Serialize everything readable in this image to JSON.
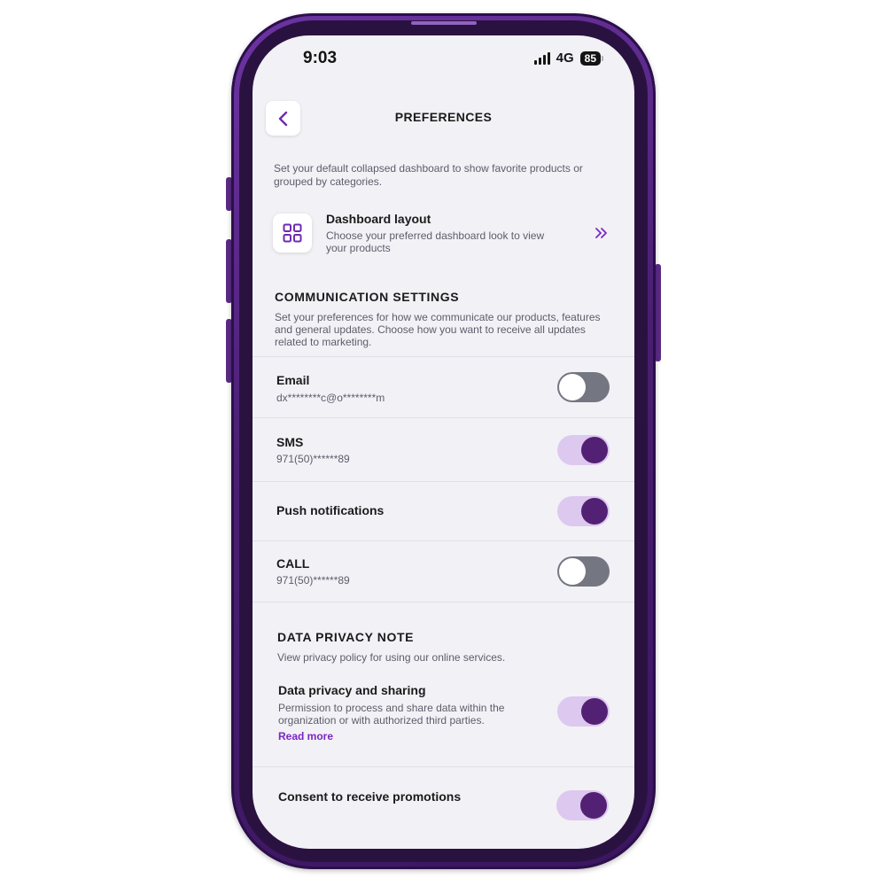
{
  "status_bar": {
    "time": "9:03",
    "network": "4G",
    "battery": "85"
  },
  "header": {
    "title": "PREFERENCES"
  },
  "intro": {
    "text": "Set your default collapsed dashboard to show favorite products or grouped by categories."
  },
  "dashboard": {
    "title": "Dashboard layout",
    "description": "Choose your preferred dashboard look to view your products"
  },
  "communication": {
    "heading": "COMMUNICATION SETTINGS",
    "description": "Set your preferences for how we communicate our products, features and general updates. Choose how you want to receive all updates related to marketing.",
    "items": [
      {
        "title": "Email",
        "subtitle": "dx********c@o********m",
        "enabled": false
      },
      {
        "title": "SMS",
        "subtitle": "971(50)******89",
        "enabled": true
      },
      {
        "title": "Push notifications",
        "enabled": true
      },
      {
        "title": "CALL",
        "subtitle": "971(50)******89",
        "enabled": false
      }
    ]
  },
  "privacy": {
    "heading": "DATA PRIVACY NOTE",
    "description": "View privacy policy for using our online services.",
    "sharing": {
      "title": "Data privacy and sharing",
      "description": "Permission to process and share data within the organization or with authorized third parties.",
      "link": "Read more",
      "enabled": true
    },
    "promotions": {
      "title": "Consent to receive promotions",
      "enabled": true
    }
  },
  "colors": {
    "accent": "#7a27c4",
    "toggle_on_track": "#ddc8ef",
    "toggle_on_knob": "#532173",
    "toggle_off_track": "#747681",
    "frame": "#4a1f73"
  }
}
